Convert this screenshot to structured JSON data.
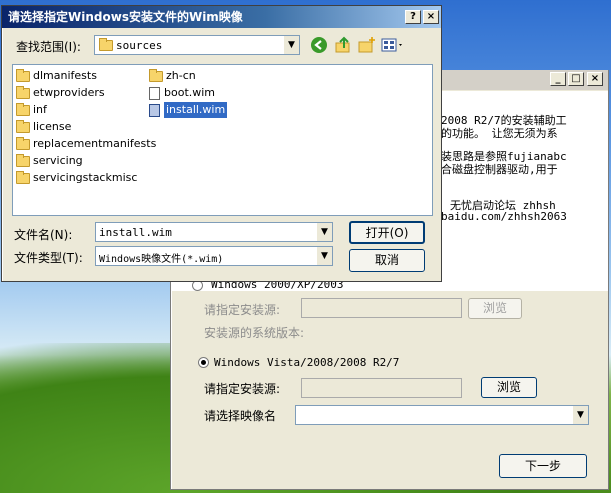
{
  "bg_window": {
    "intro_lines": [
      "2008 R2/7的安装辅助工",
      "的功能。 让您无须为系",
      "装思路是参照fujianabc",
      "合磁盘控制器驱动,用于",
      "无忧启动论坛 zhhsh",
      "baidu.com/zhhsh2063"
    ],
    "radio_xp_label": "Windows 2000/XP/2003",
    "source_label_xp": "请指定安装源:",
    "browse_label_xp": "浏览",
    "version_label": "安装源的系统版本:",
    "radio_vista_label": "Windows Vista/2008/2008 R2/7",
    "source_label_vista": "请指定安装源:",
    "browse_label_vista": "浏览",
    "image_label": "请选择映像名",
    "next_label": "下一步"
  },
  "dialog": {
    "title": "请选择指定Windows安装文件的Wim映像",
    "help_label": "?",
    "close_label": "×",
    "lookin_label": "查找范围(I):",
    "lookin_value": "sources",
    "files_col1": [
      "dlmanifests",
      "etwproviders",
      "inf",
      "license",
      "replacementmanifests",
      "servicing",
      "servicingstackmisc"
    ],
    "files_col2": [
      {
        "name": "zh-cn",
        "kind": "folder"
      },
      {
        "name": "boot.wim",
        "kind": "file"
      },
      {
        "name": "install.wim",
        "kind": "wim"
      }
    ],
    "filename_label": "文件名(N):",
    "filename_value": "install.wim",
    "filetype_label": "文件类型(T):",
    "filetype_value": "Windows映像文件(*.wim)",
    "open_label": "打开(O)",
    "cancel_label": "取消"
  }
}
